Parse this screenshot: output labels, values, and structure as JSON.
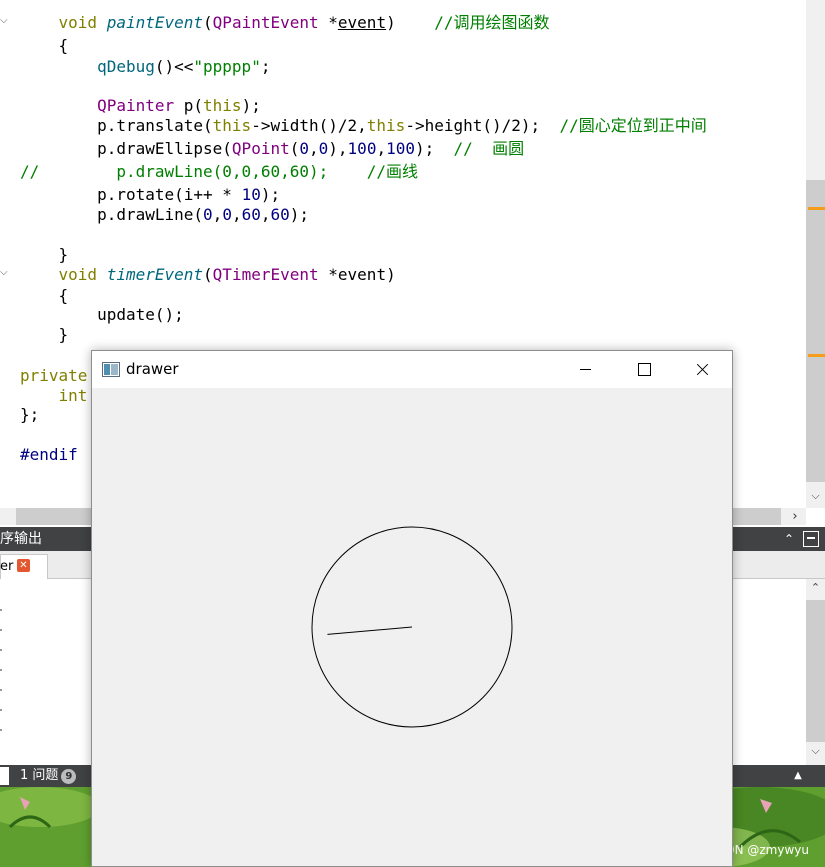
{
  "editor": {
    "lines": [
      {
        "text": "    void paintEvent(QPaintEvent *event)    //调用绘图函数"
      },
      {
        "text": "    {"
      },
      {
        "text": "        qDebug()<<\"ppppp\";"
      },
      {
        "text": ""
      },
      {
        "text": "        QPainter p(this);"
      },
      {
        "text": "        p.translate(this->width()/2,this->height()/2);  //圆心定位到正中间"
      },
      {
        "text": "        p.drawEllipse(QPoint(0,0),100,100);  //  画圆"
      },
      {
        "text": "//        p.drawLine(0,0,60,60);    //画线"
      },
      {
        "text": "        p.rotate(i++ * 10);"
      },
      {
        "text": "        p.drawLine(0,0,60,60);"
      },
      {
        "text": "    }"
      },
      {
        "text": "    void timerEvent(QTimerEvent *event)"
      },
      {
        "text": "    {"
      },
      {
        "text": "        update();"
      },
      {
        "text": "    }"
      },
      {
        "text": "private"
      },
      {
        "text": "    int"
      },
      {
        "text": "};"
      },
      {
        "text": "#endif"
      }
    ]
  },
  "output_pane": {
    "title": "序输出",
    "tab_label": "er",
    "close_icon": "close-icon"
  },
  "status": {
    "issues_label": "1  问题",
    "issues_count": "9"
  },
  "drawer_window": {
    "title": "drawer",
    "canvas": {
      "circle_radius": 100,
      "line_end": [
        60,
        60
      ],
      "rotation_degrees": 130
    }
  },
  "watermark": "CSDN @zmywyu",
  "colors": {
    "keyword": "#808000",
    "type": "#800080",
    "function": "#00677c",
    "comment": "#008000",
    "number": "#000080",
    "scroll_marker": "#f59c1a",
    "pane_header": "#404244"
  }
}
